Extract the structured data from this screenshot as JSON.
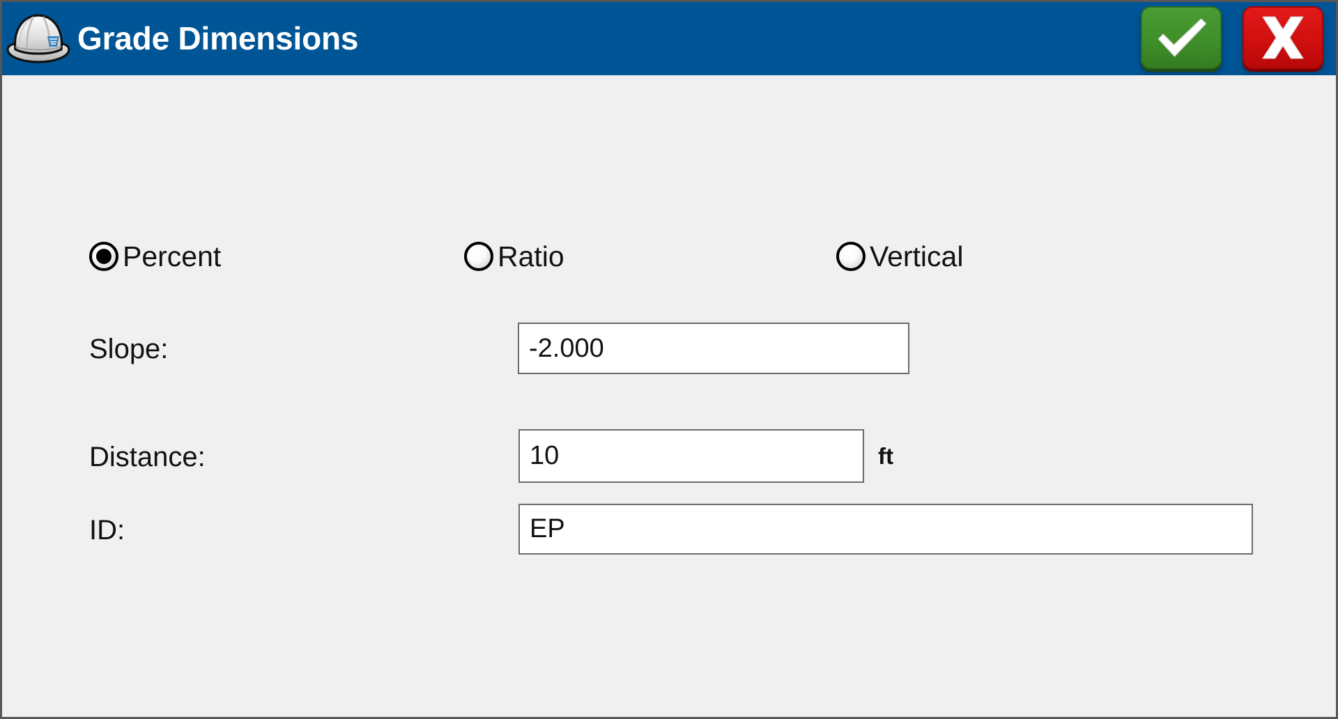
{
  "window": {
    "background": "#f0f0f0",
    "border_color": "#575757"
  },
  "titlebar": {
    "title": "Grade Dimensions",
    "background": "#005596",
    "icon_name": "hard-hat-icon",
    "buttons": [
      {
        "name": "accept-button",
        "icon": "checkmark-icon",
        "color": "#3f8f2a"
      },
      {
        "name": "cancel-button",
        "icon": "x-icon",
        "color": "#d10f0f"
      }
    ]
  },
  "form": {
    "slope_mode": {
      "selected": "Percent",
      "options": [
        {
          "label": "Percent",
          "checked": true
        },
        {
          "label": "Ratio",
          "checked": false
        },
        {
          "label": "Vertical",
          "checked": false
        }
      ]
    },
    "fields": [
      {
        "label": "Slope:",
        "value": "-2.000",
        "placeholder": "",
        "unit": ""
      },
      {
        "label": "Distance:",
        "value": "10",
        "placeholder": "",
        "unit": "ft"
      },
      {
        "label": "ID:",
        "value": "EP",
        "placeholder": "",
        "unit": ""
      }
    ]
  }
}
